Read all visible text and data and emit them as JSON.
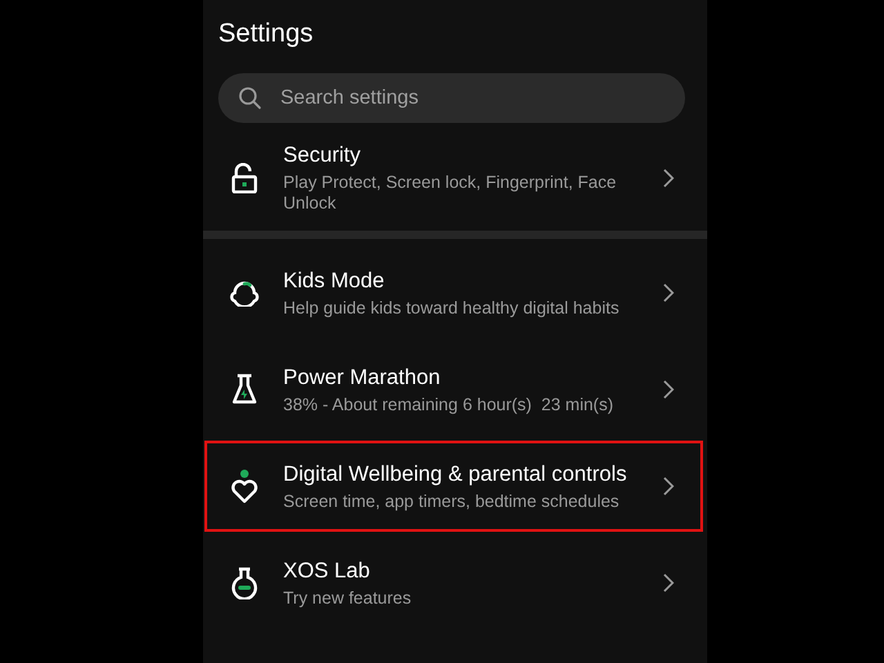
{
  "title": "Settings",
  "search": {
    "placeholder": "Search settings"
  },
  "sections": [
    {
      "items": [
        {
          "title": "Security",
          "subtitle": "Play Protect, Screen lock, Fingerprint, Face Unlock",
          "highlighted": false
        }
      ]
    },
    {
      "items": [
        {
          "title": "Kids Mode",
          "subtitle": "Help guide kids toward healthy digital habits",
          "highlighted": false
        },
        {
          "title": "Power Marathon",
          "subtitle": "38% - About remaining 6 hour(s)  23 min(s)",
          "highlighted": false
        },
        {
          "title": "Digital Wellbeing & parental controls",
          "subtitle": "Screen time, app timers, bedtime schedules",
          "highlighted": true
        },
        {
          "title": "XOS Lab",
          "subtitle": "Try new features",
          "highlighted": false
        }
      ]
    }
  ]
}
